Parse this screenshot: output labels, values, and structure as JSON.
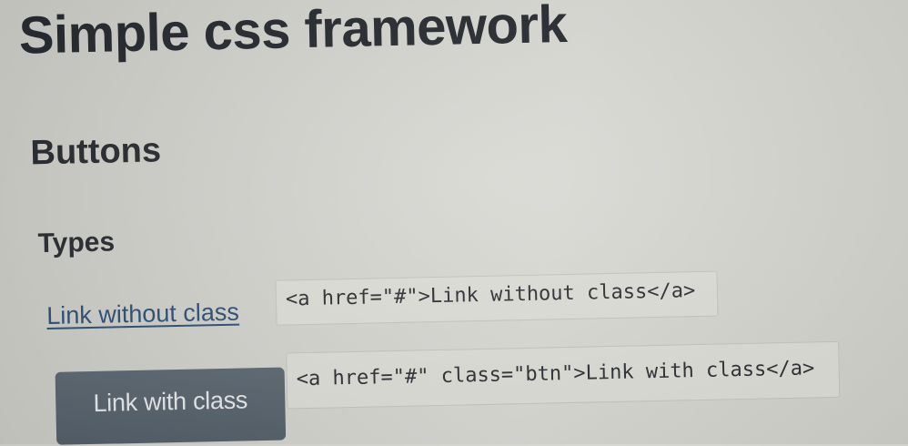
{
  "page": {
    "title": "Simple css framework",
    "section_heading": "Buttons",
    "subsection_heading": "Types"
  },
  "examples": [
    {
      "link_text": "Link without class",
      "code": "<a href=\"#\">Link without class</a>"
    },
    {
      "button_text": "Link with class",
      "code": "<a href=\"#\" class=\"btn\">Link with class</a>"
    }
  ],
  "colors": {
    "background": "#d2d2cd",
    "link": "#2c4f73",
    "button_bg": "#57636d",
    "button_text": "#e6e8ea",
    "heading": "#24282c"
  }
}
